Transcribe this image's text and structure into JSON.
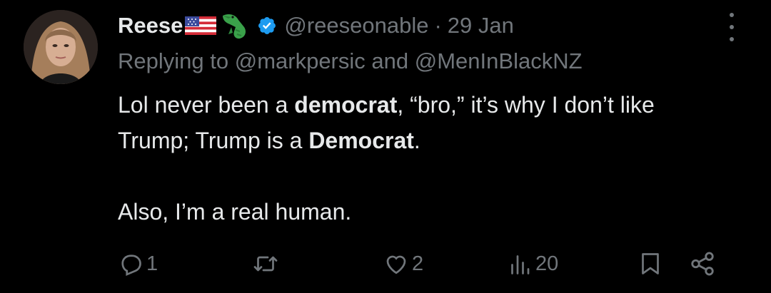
{
  "tweet": {
    "author_name": "Reese",
    "emoji_icons": [
      "us-flag-icon",
      "alligator-icon"
    ],
    "verified_icon": "verified-badge-icon",
    "handle": "@reeseonable",
    "separator": "·",
    "date": "29 Jan",
    "replying_prefix": "Replying to",
    "replying_mentions": [
      "@markpersic",
      "@MenInBlackNZ"
    ],
    "replying_joiner": "and",
    "body": {
      "line1_a": "Lol never been a ",
      "line1_bold": "democrat",
      "line1_b": ", “bro,” it’s why I don’t like",
      "line2_a": "Trump; Trump is a ",
      "line2_bold": "Democrat",
      "line2_b": ".",
      "line3": "Also, I’m a real human."
    }
  },
  "actions": {
    "reply": {
      "icon": "reply-icon",
      "count": "1"
    },
    "retweet": {
      "icon": "retweet-icon",
      "count": ""
    },
    "like": {
      "icon": "heart-icon",
      "count": "2"
    },
    "views": {
      "icon": "views-icon",
      "count": "20"
    },
    "bookmark": {
      "icon": "bookmark-icon"
    },
    "share": {
      "icon": "share-icon"
    }
  },
  "colors": {
    "background": "#000000",
    "text": "#e7e9ea",
    "secondary": "#71767b",
    "verified": "#1d9bf0"
  }
}
